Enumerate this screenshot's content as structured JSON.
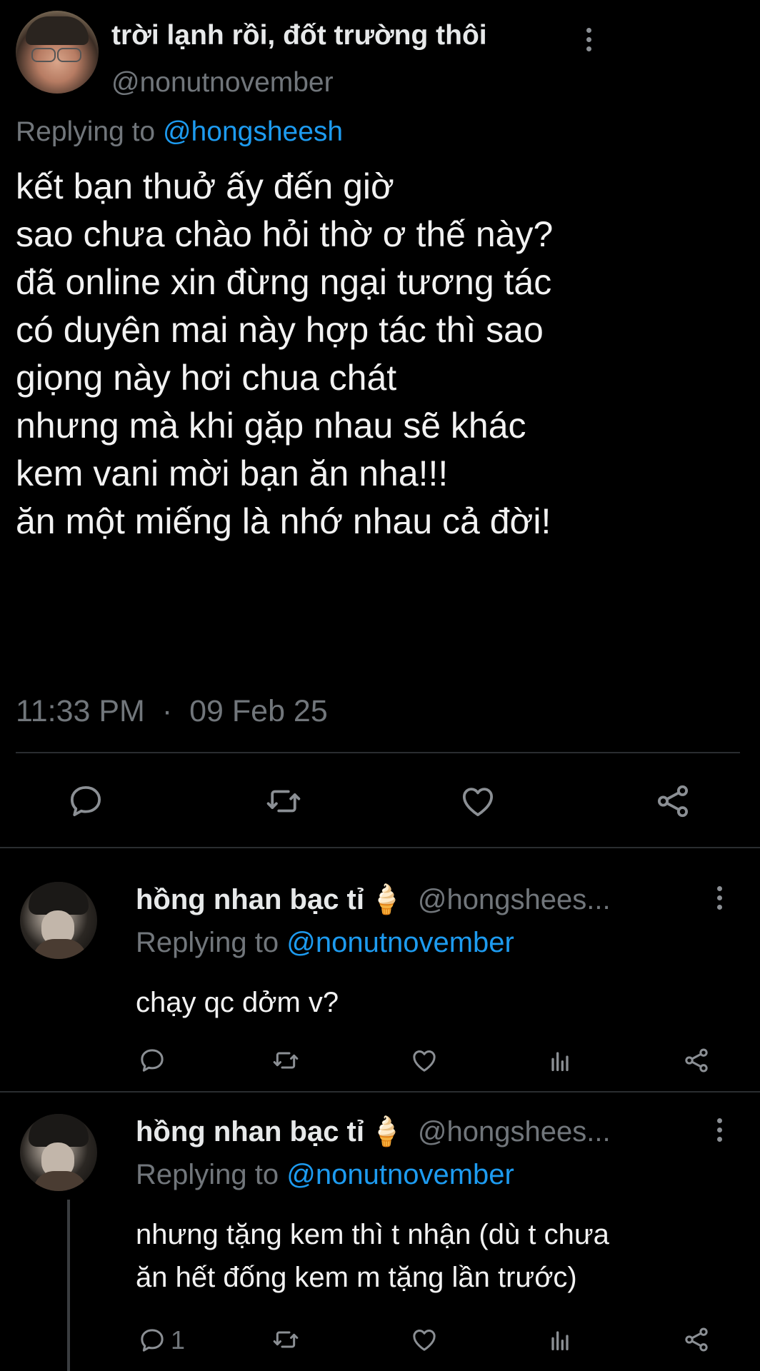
{
  "main_tweet": {
    "display_name": "trời lạnh rồi, đốt trường thôi",
    "handle": "@nonutnovember",
    "replying_prefix": "Replying to",
    "replying_to": "@hongsheesh",
    "lines": [
      "kết bạn thuở ấy đến giờ",
      "sao chưa chào hỏi thờ ơ thế này?",
      "đã online xin đừng ngại tương tác",
      "có duyên mai này hợp tác thì sao",
      "giọng này hơi chua chát",
      "nhưng mà khi gặp nhau sẽ khác",
      "kem vani mời bạn ăn nha!!!",
      "ăn một miếng là nhớ nhau cả đời!"
    ],
    "time": "11:33 PM",
    "separator": "·",
    "date": "09 Feb 25"
  },
  "replies": [
    {
      "display_name": "hồng nhan bạc tỉ",
      "emoji": "🍦",
      "handle": "@hongshees...",
      "replying_prefix": "Replying to",
      "replying_to": "@nonutnovember",
      "text_lines": [
        "chạy qc dởm v?"
      ],
      "reply_count": ""
    },
    {
      "display_name": "hồng nhan bạc tỉ",
      "emoji": "🍦",
      "handle": "@hongshees...",
      "replying_prefix": "Replying to",
      "replying_to": "@nonutnovember",
      "text_lines": [
        "nhưng tặng kem thì t nhận (dù t chưa",
        "ăn hết đống kem m tặng lần trước)"
      ],
      "reply_count": "1"
    }
  ],
  "colors": {
    "background": "#000000",
    "text": "#e7e9ea",
    "muted": "#71767b",
    "accent": "#1d9bf0"
  },
  "icons": [
    "more-icon",
    "reply-icon",
    "retweet-icon",
    "like-icon",
    "views-icon",
    "share-icon"
  ]
}
